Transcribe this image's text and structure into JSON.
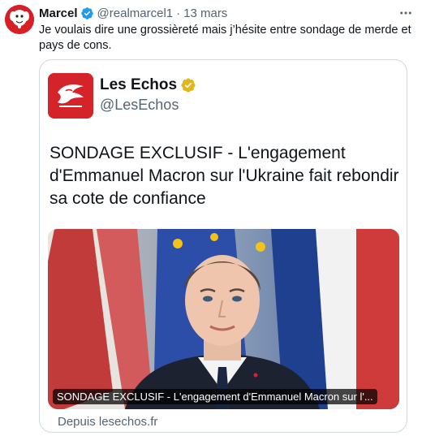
{
  "tweet": {
    "display_name": "Marcel",
    "handle": "@realmarcel1",
    "separator": "·",
    "time": "13 mars",
    "more_icon": "more-horizontal-icon",
    "text": "Je voulais dire une grossièreté mais j’hésite entre sondage de merde et pays de cons."
  },
  "quote": {
    "display_name": "Les Echos",
    "handle": "@LesEchos",
    "text": "SONDAGE EXCLUSIF - L'engagement d'Emmanuel Macron sur l'Ukraine fait rebondir sa cote de confiance",
    "media_caption": "SONDAGE EXCLUSIF - L'engagement d'Emmanuel Macron sur l'...",
    "source": "Depuis lesechos.fr"
  },
  "colors": {
    "brand_red": "#d5232a",
    "verified_blue": "#1d9bf0",
    "verified_gold": "#e2b719",
    "muted": "#536471",
    "border": "#cfd9de"
  }
}
